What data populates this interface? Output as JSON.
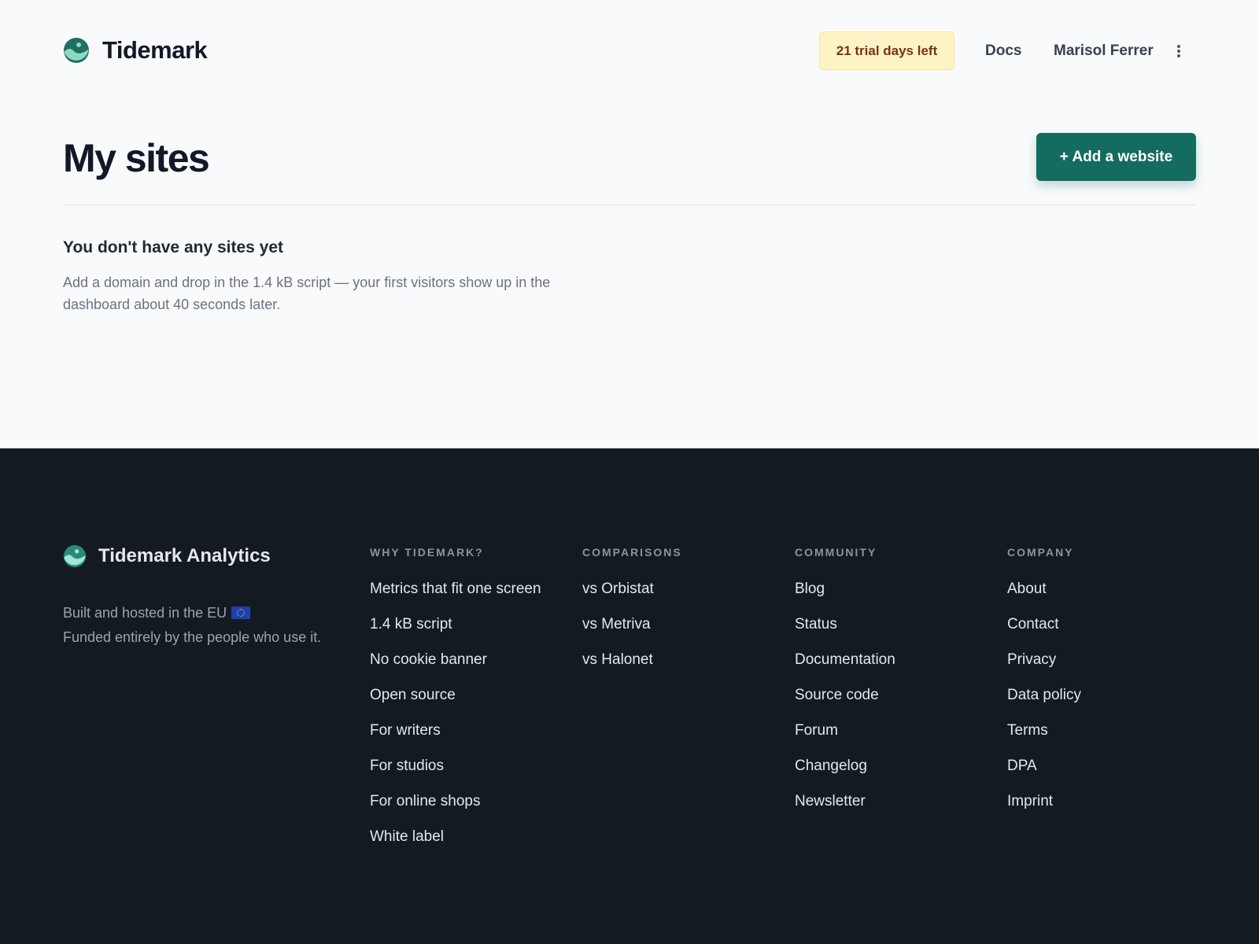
{
  "header": {
    "brand": "Tidemark",
    "logo_icon": "wave-globe-icon",
    "trial_badge": "21 trial days left",
    "docs_link": "Docs",
    "user_name": "Marisol Ferrer",
    "menu_icon": "kebab-menu-icon"
  },
  "main": {
    "title": "My sites",
    "add_button": "+ Add a website",
    "empty_title": "You don't have any sites yet",
    "empty_description": "Add a domain and drop in the 1.4 kB script — your first visitors show up in the dashboard about 40 seconds later."
  },
  "footer": {
    "brand": "Tidemark Analytics",
    "tagline_line1": "Built and hosted in the EU",
    "tagline_line2": "Funded entirely by the people who use it.",
    "columns": [
      {
        "heading": "WHY TIDEMARK?",
        "links": [
          "Metrics that fit one screen",
          "1.4 kB script",
          "No cookie banner",
          "Open source",
          "For writers",
          "For studios",
          "For online shops",
          "White label"
        ]
      },
      {
        "heading": "COMPARISONS",
        "links": [
          "vs Orbistat",
          "vs Metriva",
          "vs Halonet"
        ]
      },
      {
        "heading": "COMMUNITY",
        "links": [
          "Blog",
          "Status",
          "Documentation",
          "Source code",
          "Forum",
          "Changelog",
          "Newsletter"
        ]
      },
      {
        "heading": "COMPANY",
        "links": [
          "About",
          "Contact",
          "Privacy",
          "Data policy",
          "Terms",
          "DPA",
          "Imprint"
        ]
      }
    ]
  },
  "colors": {
    "accent": "#146b5f",
    "badge_bg": "#fef3c7",
    "badge_text": "#78350f",
    "footer_bg": "#131b21"
  }
}
